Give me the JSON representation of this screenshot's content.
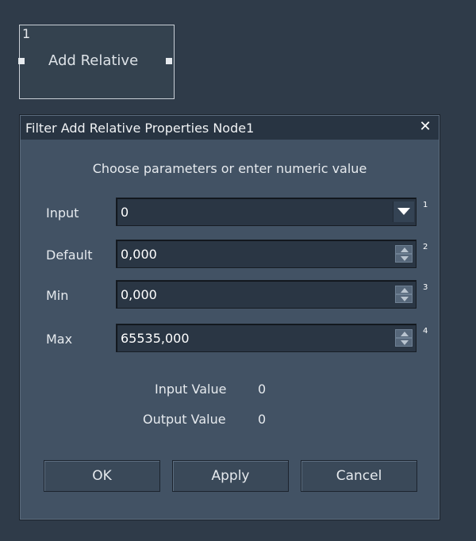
{
  "node": {
    "number": "1",
    "title": "Add Relative"
  },
  "dialog": {
    "title": "Filter Add Relative Properties Node1",
    "close_icon": "close-icon",
    "instruction": "Choose parameters or enter numeric value",
    "rows": [
      {
        "label": "Input",
        "value": "0",
        "control": "dropdown",
        "index": "1"
      },
      {
        "label": "Default",
        "value": "0,000",
        "control": "spinner",
        "index": "2"
      },
      {
        "label": "Min",
        "value": "0,000",
        "control": "spinner",
        "index": "3"
      },
      {
        "label": "Max",
        "value": "65535,000",
        "control": "spinner",
        "index": "4"
      }
    ],
    "input_value_label": "Input Value",
    "input_value": "0",
    "output_value_label": "Output Value",
    "output_value": "0",
    "buttons": {
      "ok": "OK",
      "apply": "Apply",
      "cancel": "Cancel"
    }
  },
  "colors": {
    "background": "#2f3b49",
    "dialog": "#425264",
    "titlebar": "#283442",
    "field": "#2a3644"
  }
}
